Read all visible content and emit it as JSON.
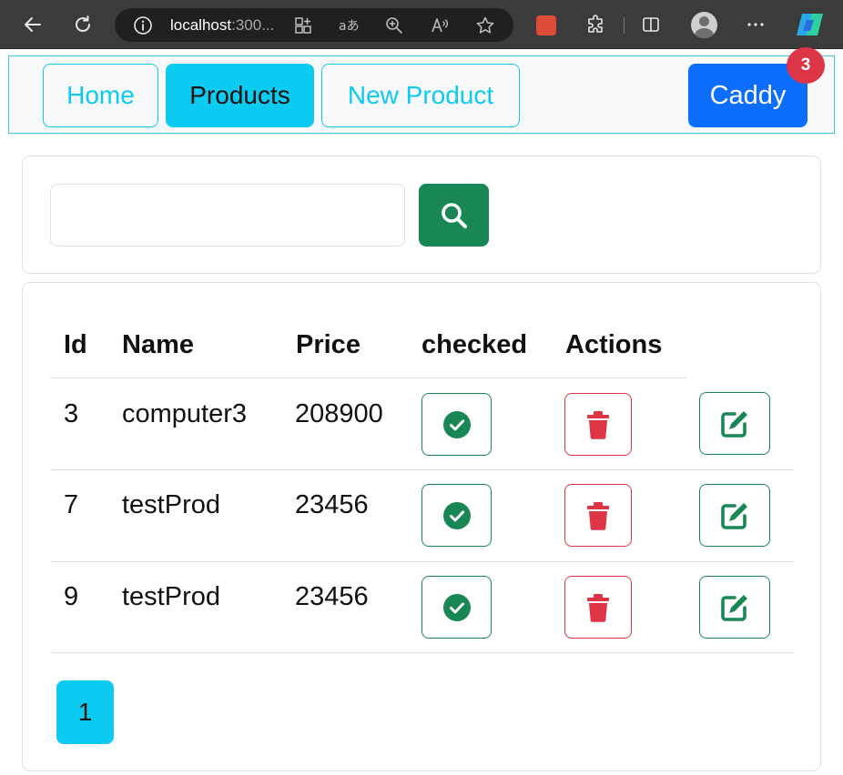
{
  "browser": {
    "url_host": "localhost",
    "url_rest": ":300..."
  },
  "nav": {
    "home_label": "Home",
    "products_label": "Products",
    "new_product_label": "New Product",
    "caddy_label": "Caddy",
    "caddy_count": "3"
  },
  "search": {
    "value": "",
    "placeholder": ""
  },
  "table": {
    "headers": [
      "Id",
      "Name",
      "Price",
      "checked",
      "Actions"
    ],
    "rows": [
      {
        "id": "3",
        "name": "computer3",
        "price": "208900",
        "checked": true
      },
      {
        "id": "7",
        "name": "testProd",
        "price": "23456",
        "checked": true
      },
      {
        "id": "9",
        "name": "testProd",
        "price": "23456",
        "checked": true
      }
    ]
  },
  "pagination": {
    "pages": [
      "1"
    ],
    "current": "1"
  },
  "colors": {
    "info": "#0dcaf0",
    "primary": "#0d6efd",
    "success": "#198754",
    "danger": "#dc3545"
  },
  "icons": [
    "back-icon",
    "refresh-icon",
    "info-icon",
    "search-icon",
    "check-circle-icon",
    "trash-icon",
    "edit-icon"
  ]
}
